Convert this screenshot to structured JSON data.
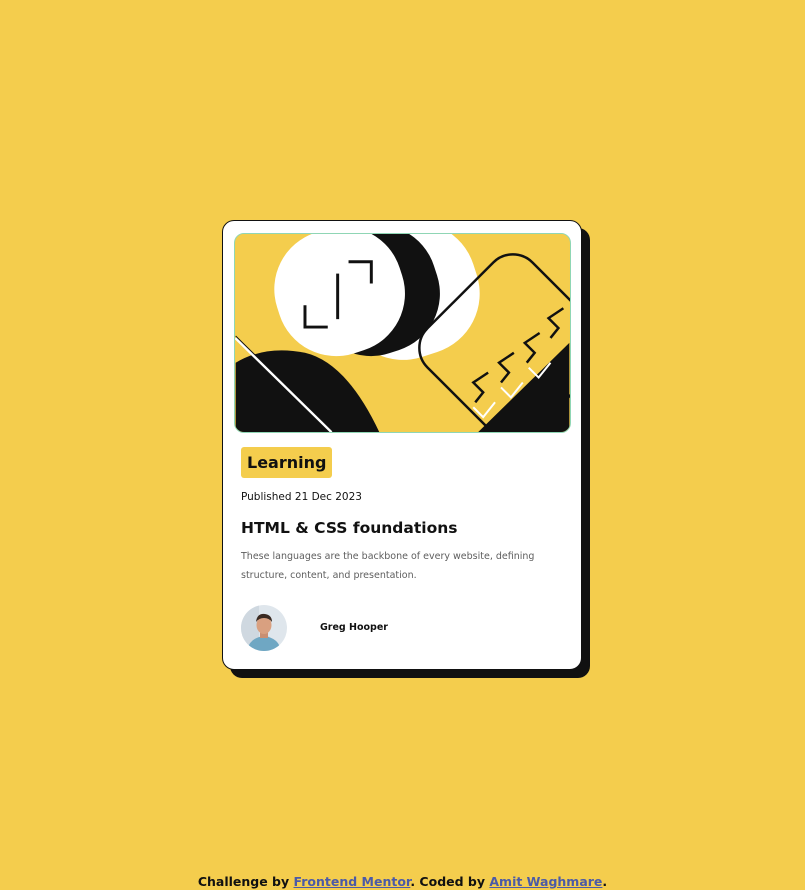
{
  "card": {
    "tag": "Learning",
    "published": "Published 21 Dec 2023",
    "title": "HTML & CSS foundations",
    "description": "These languages are the backbone of every website, defining structure, content, and presentation.",
    "author": "Greg Hooper"
  },
  "attribution": {
    "prefix": "Challenge by ",
    "link1": "Frontend Mentor",
    "middle": ". Coded by ",
    "link2": "Amit Waghmare",
    "suffix": "."
  },
  "colors": {
    "background": "#f4cd4d",
    "card": "#ffffff",
    "ink": "#111111",
    "muted": "#5e5e5e",
    "link": "#4b5aa7"
  }
}
